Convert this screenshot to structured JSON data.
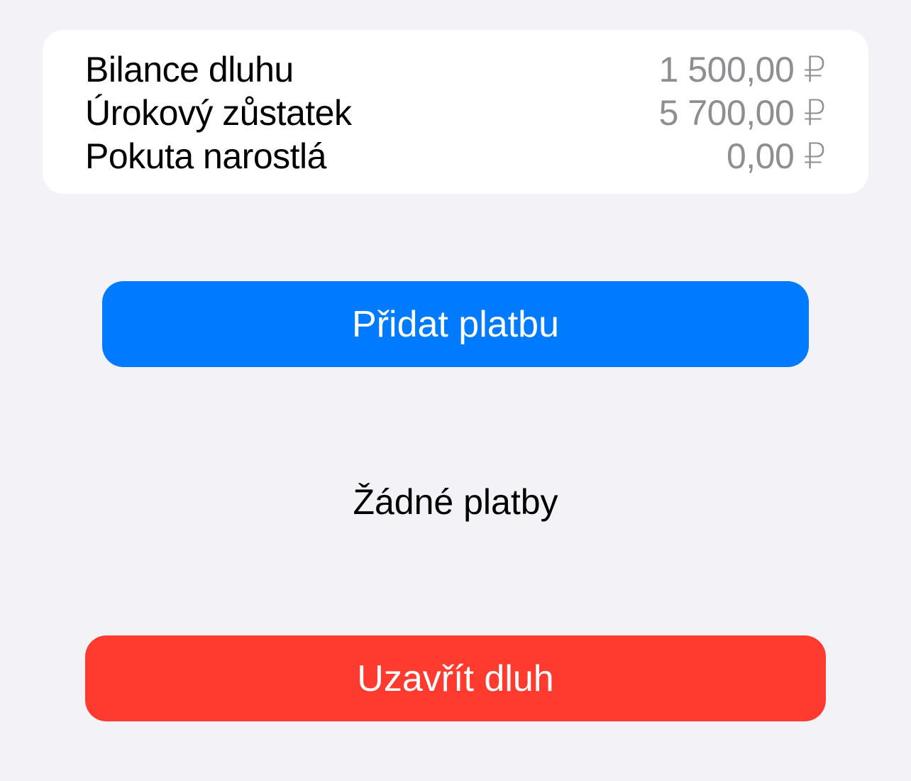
{
  "summary": {
    "rows": [
      {
        "label": "Bilance dluhu",
        "value": "1 500,00 ₽"
      },
      {
        "label": "Úrokový zůstatek",
        "value": "5 700,00 ₽"
      },
      {
        "label": "Pokuta narostlá",
        "value": "0,00 ₽"
      }
    ]
  },
  "actions": {
    "add_payment_label": "Přidat platbu",
    "close_debt_label": "Uzavřít dluh"
  },
  "payments": {
    "empty_text": "Žádné platby"
  },
  "colors": {
    "background": "#f2f2f7",
    "card": "#ffffff",
    "accent_blue": "#007aff",
    "destructive_red": "#ff3b30",
    "secondary_text": "#8e8e93"
  }
}
